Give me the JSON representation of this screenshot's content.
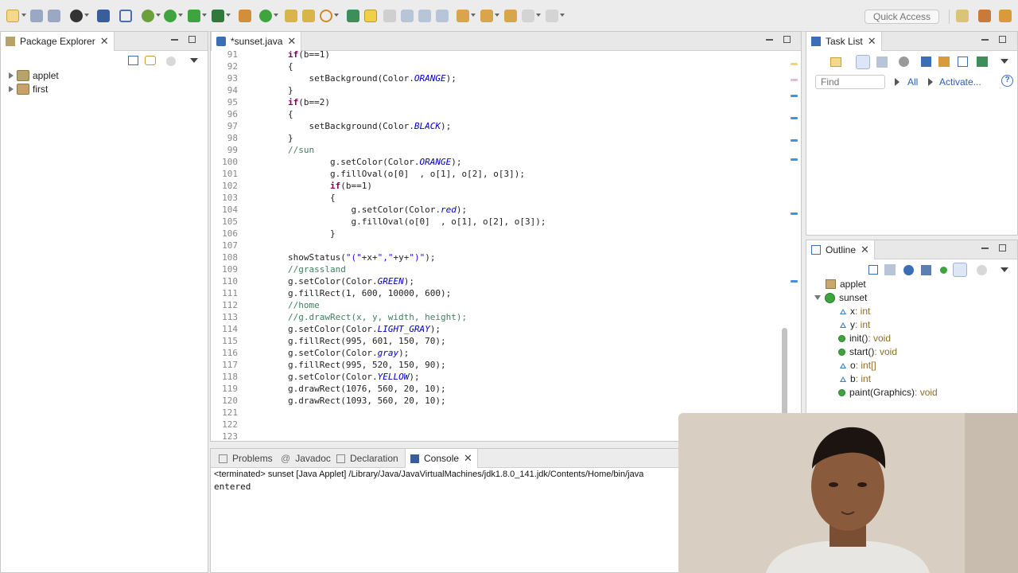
{
  "toolbar": {
    "quick_access_placeholder": "Quick Access"
  },
  "package_explorer": {
    "tab_label": "Package Explorer",
    "items": [
      {
        "label": "applet"
      },
      {
        "label": "first"
      }
    ]
  },
  "editor": {
    "tab_label": "*sunset.java",
    "lines": [
      {
        "num": "91",
        "code": "        if(b==1)"
      },
      {
        "num": "92",
        "code": "        {"
      },
      {
        "num": "93",
        "code": "            setBackground(Color.ORANGE);"
      },
      {
        "num": "94",
        "code": "        }"
      },
      {
        "num": "95",
        "code": "        if(b==2)"
      },
      {
        "num": "96",
        "code": "        {"
      },
      {
        "num": "97",
        "code": "            setBackground(Color.BLACK);"
      },
      {
        "num": "98",
        "code": "        }"
      },
      {
        "num": "99",
        "code": "        //sun"
      },
      {
        "num": "100",
        "code": "                g.setColor(Color.ORANGE);"
      },
      {
        "num": "101",
        "code": "                g.fillOval(o[0]  , o[1], o[2], o[3]);"
      },
      {
        "num": "102",
        "code": "                if(b==1)"
      },
      {
        "num": "103",
        "code": "                {"
      },
      {
        "num": "104",
        "code": "                    g.setColor(Color.red);"
      },
      {
        "num": "105",
        "code": "                    g.fillOval(o[0]  , o[1], o[2], o[3]);"
      },
      {
        "num": "106",
        "code": "                }"
      },
      {
        "num": "107",
        "code": ""
      },
      {
        "num": "108",
        "code": "        showStatus(\"(\"+x+\",\"+y+\")\");"
      },
      {
        "num": "109",
        "code": "        //grassland"
      },
      {
        "num": "110",
        "code": "        g.setColor(Color.GREEN);"
      },
      {
        "num": "111",
        "code": "        g.fillRect(1, 600, 10000, 600);"
      },
      {
        "num": "112",
        "code": "        //home"
      },
      {
        "num": "113",
        "code": "        //g.drawRect(x, y, width, height);"
      },
      {
        "num": "114",
        "code": "        g.setColor(Color.LIGHT_GRAY);"
      },
      {
        "num": "115",
        "code": "        g.fillRect(995, 601, 150, 70);"
      },
      {
        "num": "116",
        "code": "        g.setColor(Color.gray);"
      },
      {
        "num": "117",
        "code": "        g.fillRect(995, 520, 150, 90);"
      },
      {
        "num": "118",
        "code": "        g.setColor(Color.YELLOW);"
      },
      {
        "num": "119",
        "code": "        g.drawRect(1076, 560, 20, 10);"
      },
      {
        "num": "120",
        "code": "        g.drawRect(1093, 560, 20, 10);"
      },
      {
        "num": "121",
        "code": ""
      },
      {
        "num": "122",
        "code": ""
      },
      {
        "num": "123",
        "code": ""
      }
    ]
  },
  "bottom_panel": {
    "tabs": [
      {
        "label": "Problems"
      },
      {
        "label": "Javadoc"
      },
      {
        "label": "Declaration"
      },
      {
        "label": "Console"
      }
    ],
    "console_header": "<terminated> sunset [Java Applet] /Library/Java/JavaVirtualMachines/jdk1.8.0_141.jdk/Contents/Home/bin/java",
    "console_output": "entered"
  },
  "task_list": {
    "tab_label": "Task List",
    "find_placeholder": "Find",
    "all_label": "All",
    "activate_label": "Activate..."
  },
  "outline": {
    "tab_label": "Outline",
    "items": [
      {
        "name": "applet",
        "type": ""
      },
      {
        "name": "sunset",
        "type": ""
      },
      {
        "name": "x",
        "type": " : int"
      },
      {
        "name": "y",
        "type": " : int"
      },
      {
        "name": "init()",
        "type": " : void"
      },
      {
        "name": "start()",
        "type": " : void"
      },
      {
        "name": "o",
        "type": " : int[]"
      },
      {
        "name": "b",
        "type": " : int"
      },
      {
        "name": "paint(Graphics)",
        "type": " : void"
      }
    ]
  },
  "colors": {
    "keyword": "#7f0055",
    "string": "#2a00ff",
    "comment": "#3f7f5f",
    "static_field": "#0000c0",
    "marker_blue": "#4a90d9"
  }
}
